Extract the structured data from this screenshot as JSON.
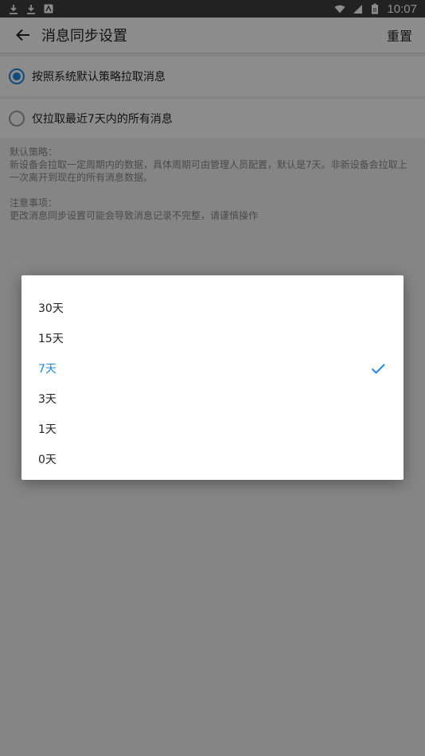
{
  "status_bar": {
    "time": "10:07",
    "battery_badge": "B"
  },
  "toolbar": {
    "title": "消息同步设置",
    "reset_label": "重置"
  },
  "options": [
    {
      "label": "按照系统默认策略拉取消息",
      "checked": true
    },
    {
      "label": "仅拉取最近7天内的所有消息",
      "checked": false
    }
  ],
  "notes": {
    "default_policy_heading": "默认策略：",
    "default_policy_text": "新设备会拉取一定周期内的数据，具体周期可由管理人员配置，默认是7天。非新设备会拉取上一次离开到现在的所有消息数据。",
    "caution_heading": "注意事项：",
    "caution_text": "更改消息同步设置可能会导致消息记录不完整，请谨慎操作"
  },
  "dialog": {
    "items": [
      {
        "label": "30天"
      },
      {
        "label": "15天"
      },
      {
        "label": "7天"
      },
      {
        "label": "3天"
      },
      {
        "label": "1天"
      },
      {
        "label": "0天"
      }
    ],
    "selected_index": 2
  },
  "colors": {
    "accent": "#1e88e5",
    "status_bar": "#3e3e3e",
    "overlay": "rgba(0,0,0,0.45)"
  }
}
